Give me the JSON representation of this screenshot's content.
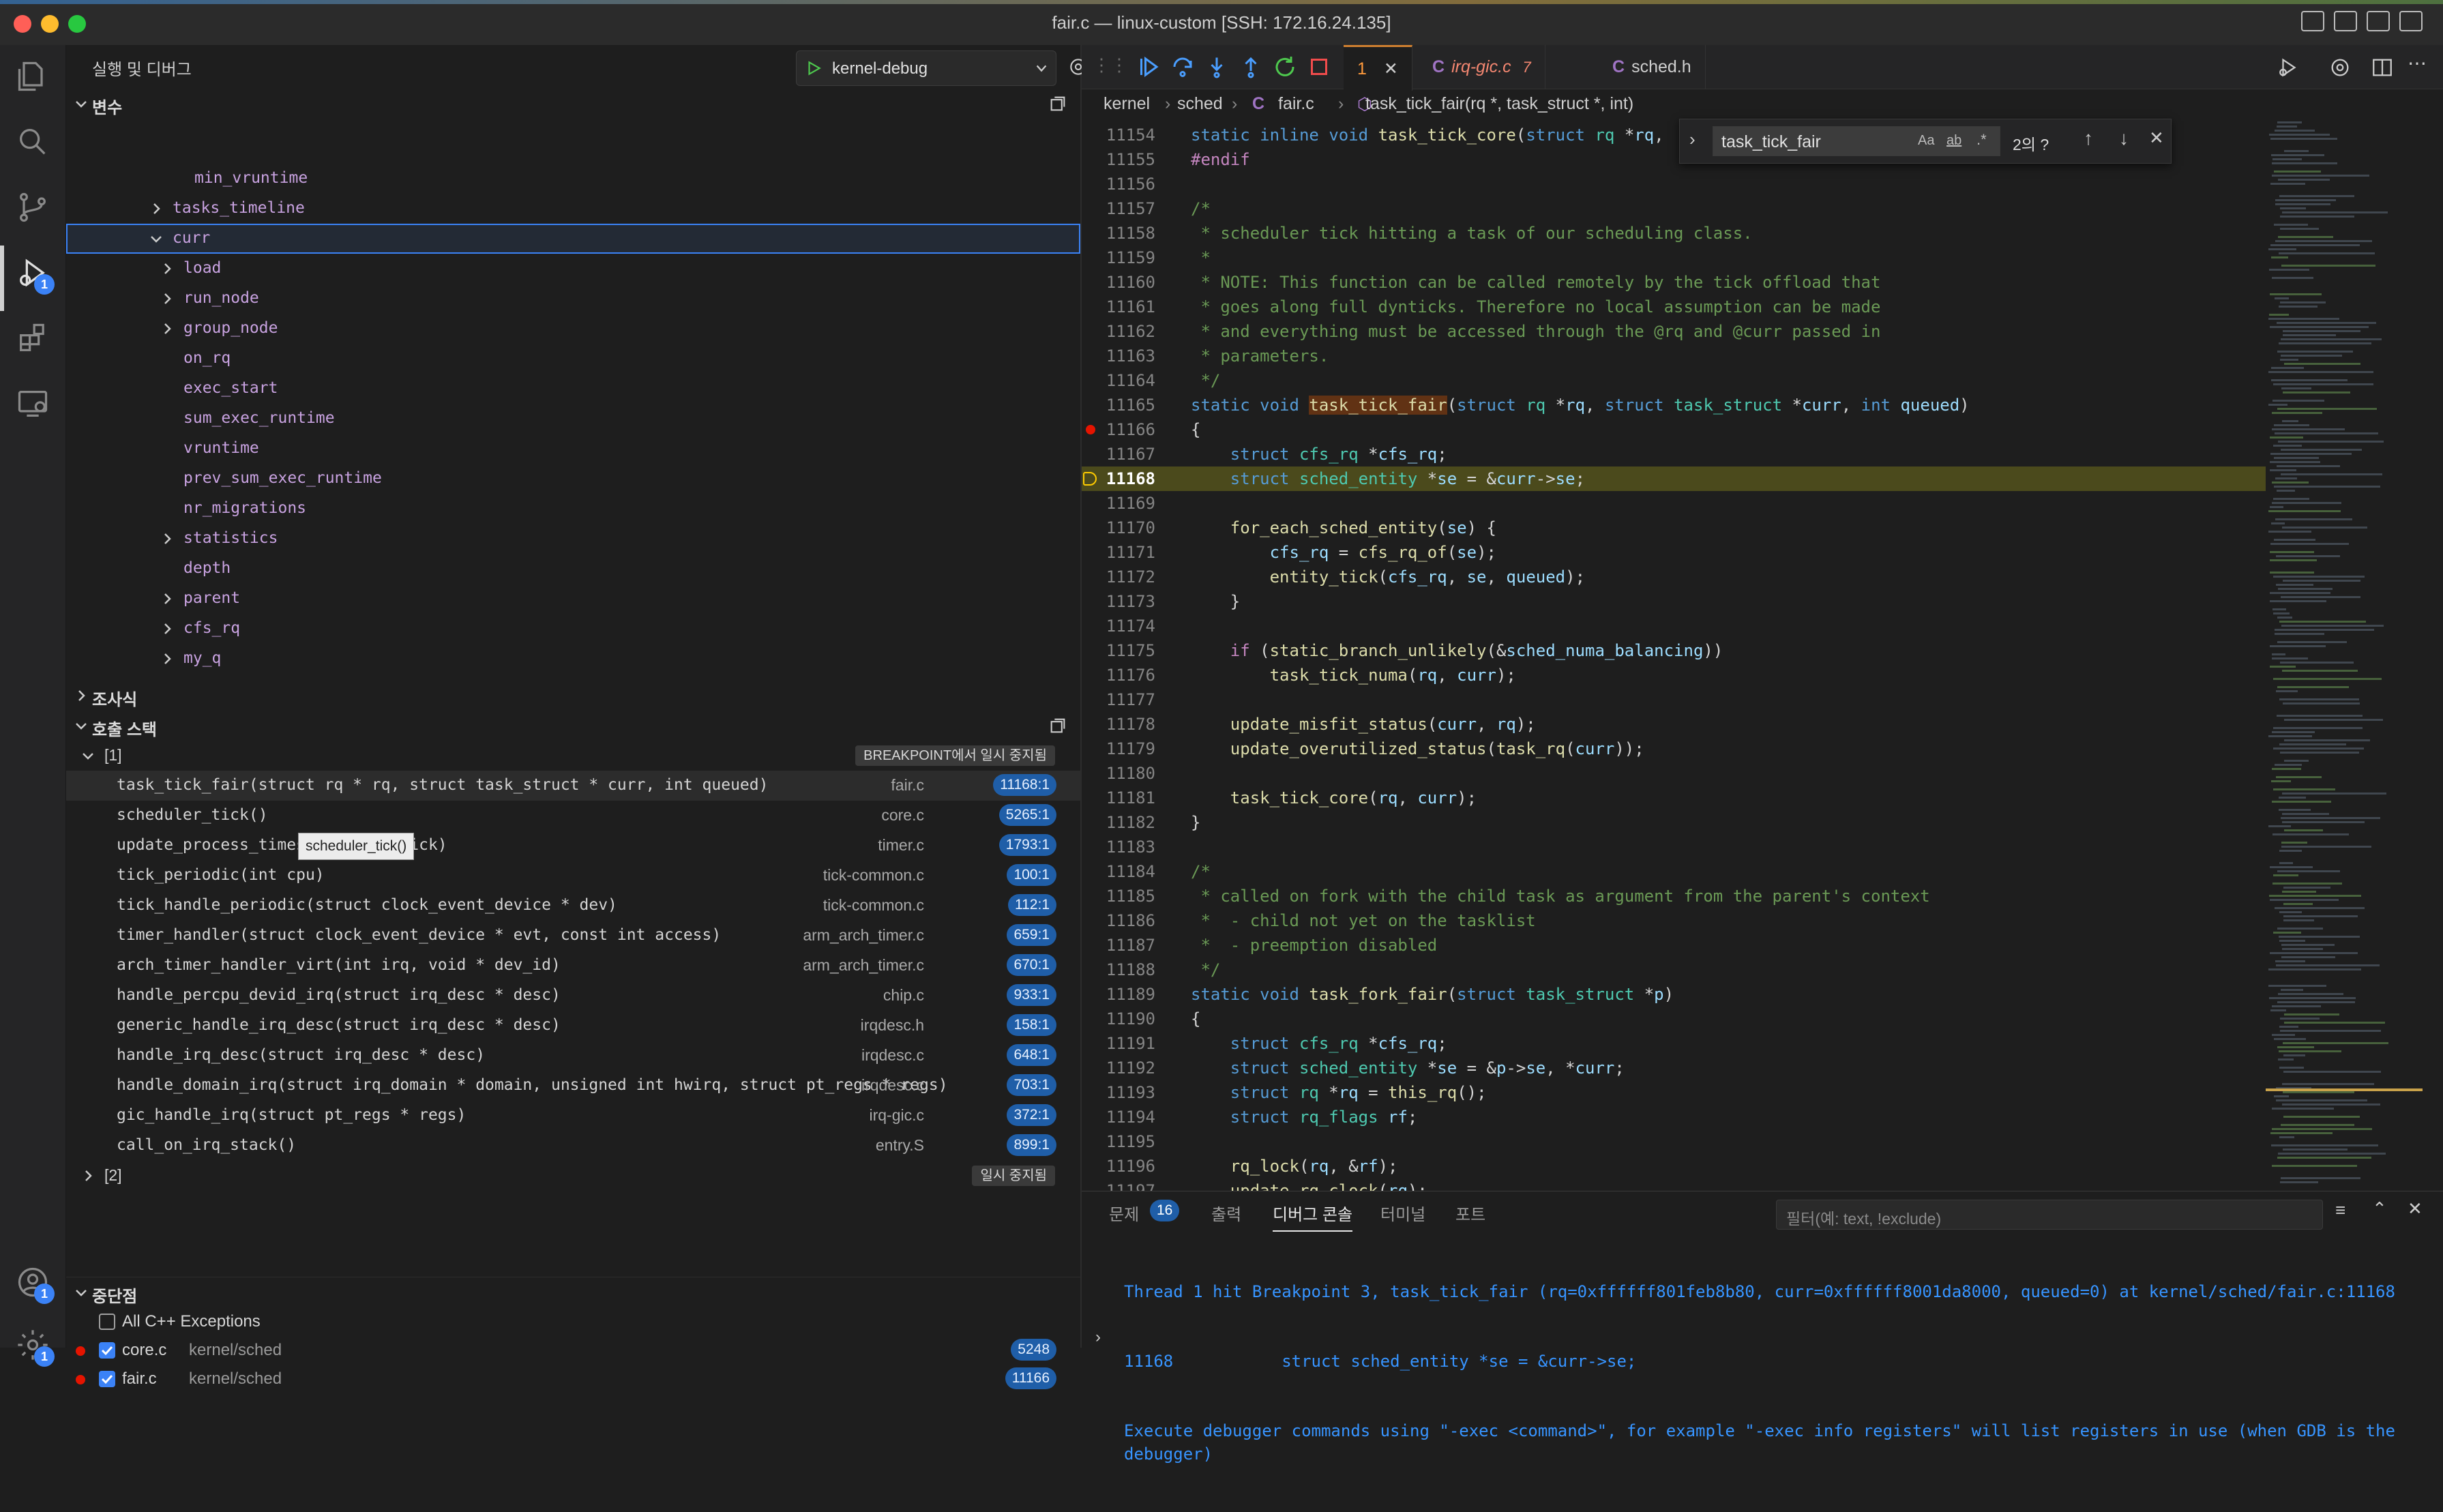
{
  "window": {
    "title": "fair.c — linux-custom [SSH: 172.16.24.135]"
  },
  "activity": {
    "debug_badge": "1",
    "accounts_badge": "1",
    "settings_badge": "1"
  },
  "sidebar": {
    "title": "실행 및 디버그",
    "config": "kernel-debug",
    "variables_title": "변수",
    "variables": [
      {
        "label": "min_vruntime",
        "expandable": false,
        "indent": 1
      },
      {
        "label": "tasks_timeline",
        "expandable": true,
        "indent": 1
      },
      {
        "label": "curr",
        "expandable": true,
        "expanded": true,
        "indent": 1
      },
      {
        "label": "load",
        "expandable": true,
        "indent": 2
      },
      {
        "label": "run_node",
        "expandable": true,
        "indent": 2
      },
      {
        "label": "group_node",
        "expandable": true,
        "indent": 2
      },
      {
        "label": "on_rq",
        "expandable": false,
        "indent": 2
      },
      {
        "label": "exec_start",
        "expandable": false,
        "indent": 2
      },
      {
        "label": "sum_exec_runtime",
        "expandable": false,
        "indent": 2
      },
      {
        "label": "vruntime",
        "expandable": false,
        "indent": 2
      },
      {
        "label": "prev_sum_exec_runtime",
        "expandable": false,
        "indent": 2
      },
      {
        "label": "nr_migrations",
        "expandable": false,
        "indent": 2
      },
      {
        "label": "statistics",
        "expandable": true,
        "indent": 2
      },
      {
        "label": "depth",
        "expandable": false,
        "indent": 2
      },
      {
        "label": "parent",
        "expandable": true,
        "indent": 2
      },
      {
        "label": "cfs_rq",
        "expandable": true,
        "indent": 2
      },
      {
        "label": "my_q",
        "expandable": true,
        "indent": 2
      }
    ],
    "watch_title": "조사식",
    "callstack_title": "호출 스택",
    "thread1": {
      "label": "[1]",
      "status": "BREAKPOINT에서 일시 중지됨"
    },
    "thread2": {
      "label": "[2]",
      "status": "일시 중지됨"
    },
    "frames": [
      {
        "fn": "task_tick_fair(struct rq * rq, struct task_struct * curr, int queued)",
        "file": "fair.c",
        "line": "11168:1"
      },
      {
        "fn": "scheduler_tick()",
        "file": "core.c",
        "line": "5265:1"
      },
      {
        "fn": "update_process_times(int user_tick)",
        "file": "timer.c",
        "line": "1793:1"
      },
      {
        "fn": "tick_periodic(int cpu)",
        "file": "tick-common.c",
        "line": "100:1"
      },
      {
        "fn": "tick_handle_periodic(struct clock_event_device * dev)",
        "file": "tick-common.c",
        "line": "112:1"
      },
      {
        "fn": "timer_handler(struct clock_event_device * evt, const int access)",
        "file": "arm_arch_timer.c",
        "line": "659:1"
      },
      {
        "fn": "arch_timer_handler_virt(int irq, void * dev_id)",
        "file": "arm_arch_timer.c",
        "line": "670:1"
      },
      {
        "fn": "handle_percpu_devid_irq(struct irq_desc * desc)",
        "file": "chip.c",
        "line": "933:1"
      },
      {
        "fn": "generic_handle_irq_desc(struct irq_desc * desc)",
        "file": "irqdesc.h",
        "line": "158:1"
      },
      {
        "fn": "handle_irq_desc(struct irq_desc * desc)",
        "file": "irqdesc.c",
        "line": "648:1"
      },
      {
        "fn": "handle_domain_irq(struct irq_domain * domain, unsigned int hwirq, struct pt_regs * regs)",
        "file": "irqdesc.c",
        "line": "703:1"
      },
      {
        "fn": "gic_handle_irq(struct pt_regs * regs)",
        "file": "irq-gic.c",
        "line": "372:1"
      },
      {
        "fn": "call_on_irq_stack()",
        "file": "entry.S",
        "line": "899:1"
      }
    ],
    "tooltip": "scheduler_tick()",
    "breakpoints_title": "중단점",
    "breakpoints": [
      {
        "label": "All C++ Exceptions",
        "path": "",
        "count": "",
        "checked": false,
        "dot": false
      },
      {
        "label": "core.c",
        "path": "kernel/sched",
        "count": "5248",
        "checked": true,
        "dot": true
      },
      {
        "label": "fair.c",
        "path": "kernel/sched",
        "count": "11166",
        "checked": true,
        "dot": true
      }
    ]
  },
  "editor": {
    "tabs": [
      {
        "label": "1",
        "active": true
      },
      {
        "label": "irq-gic.c",
        "badge": "7",
        "modified": true
      },
      {
        "label": "sched.h"
      }
    ],
    "breadcrumb": [
      "kernel",
      "sched",
      "fair.c",
      "task_tick_fair(rq *, task_struct *, int)"
    ],
    "find": {
      "query": "task_tick_fair",
      "result": "2의 ?",
      "opt_case": "Aa",
      "opt_word": "ab",
      "opt_regex": ".*"
    },
    "current_line": "11168",
    "breakpoint_line": "11166",
    "first_line": 11154
  },
  "panel": {
    "tabs": [
      "문제",
      "출력",
      "디버그 콘솔",
      "터미널",
      "포트"
    ],
    "problems_count": "16",
    "active_tab": "디버그 콘솔",
    "filter_placeholder": "필터(예: text, !exclude)",
    "console": [
      "Thread 1 hit Breakpoint 3, task_tick_fair (rq=0xffffff801feb8b80, curr=0xffffff8001da8000, queued=0) at kernel/sched/fair.c:11168",
      "11168\t\tstruct sched_entity *se = &curr->se;",
      "Execute debugger commands using \"-exec <command>\", for example \"-exec info registers\" will list registers in use (when GDB is the debugger)"
    ]
  },
  "colors": {
    "accent": "#3b82f6",
    "breakpoint": "#e51400",
    "current_line_bg": "#4b4a1c"
  }
}
